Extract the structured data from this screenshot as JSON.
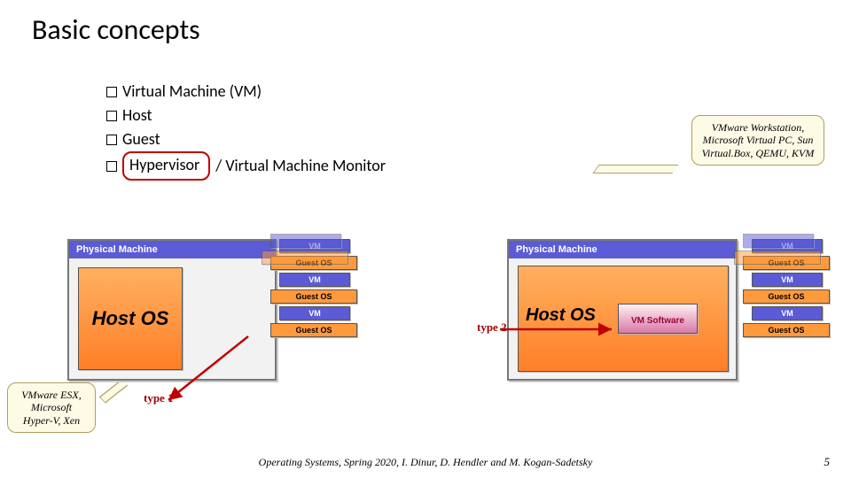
{
  "title": "Basic concepts",
  "bullets": {
    "b1": "Virtual Machine (VM)",
    "b2": "Host",
    "b3": "Guest",
    "b4a": "Hypervisor",
    "b4b": "/  Virtual Machine Monitor"
  },
  "callouts": {
    "right": "VMware Workstation, Microsoft Virtual PC, Sun Virtual.Box, QEMU, KVM",
    "left": "VMware ESX, Microsoft Hyper-V, Xen"
  },
  "labels": {
    "vm_software": "VM Software",
    "type1": "type 1",
    "type2": "type 2",
    "physical_machine": "Physical Machine",
    "host_os": "Host OS",
    "vm": "VM",
    "guest_os": "Guest OS",
    "vm_software_box": "VM\nSoftware"
  },
  "footer": "Operating Systems, Spring 2020, I. Dinur, D. Hendler and M. Kogan-Sadetsky",
  "page": "5"
}
